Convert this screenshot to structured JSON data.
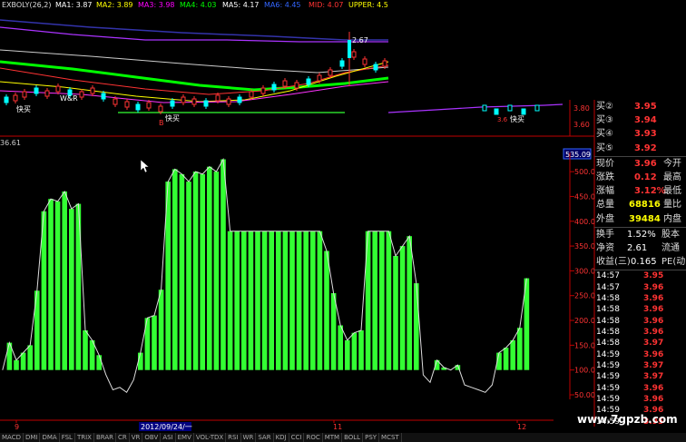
{
  "header": {
    "indicator": "EXBOLY(26,2)",
    "ma1": "MA1: 3.87",
    "ma2": "MA2: 3.89",
    "ma3": "MA3: 3.98",
    "ma4": "MA4: 4.03",
    "ma5": "MA5: 4.17",
    "ma6": "MA6: 4.45",
    "mid": "MID: 4.07",
    "upper": "UPPER: 4.5"
  },
  "upper_axis": [
    "3.80",
    "3.60"
  ],
  "upper_annotations": {
    "kuaimai_left": "快买",
    "wr": "W&R",
    "buy_marks": "B",
    "kuaimai_mid": "快买",
    "price_peak": "2.67",
    "kuaimai_right": "快买",
    "small_label": "3.6"
  },
  "lower_panel": {
    "title_value": "36.61",
    "current_marker": "535.09",
    "y_labels": [
      "500.0",
      "450.0",
      "400.0",
      "350.0",
      "300.0",
      "250.0",
      "200.0",
      "150.0",
      "100.0",
      "50.00"
    ]
  },
  "chart_data": {
    "type": "bar",
    "series": [
      {
        "values": [
          100,
          155,
          120,
          135,
          150,
          260,
          420,
          445,
          440,
          460,
          425,
          435,
          180,
          160,
          130,
          90,
          60,
          65,
          55,
          80,
          135,
          205,
          210,
          262,
          480,
          505,
          495,
          480,
          500,
          495,
          510,
          500,
          525,
          380,
          380,
          380,
          380,
          380,
          380,
          380,
          380,
          380,
          380,
          380,
          380,
          380,
          380,
          340,
          255,
          190,
          160,
          175,
          180,
          380,
          380,
          380,
          380,
          330,
          350,
          370,
          275,
          90,
          75,
          120,
          105,
          100,
          110,
          70,
          65,
          60,
          55,
          70,
          135,
          145,
          160,
          185,
          285
        ]
      }
    ],
    "ylim": [
      50,
      535
    ]
  },
  "quote": {
    "bids": [
      {
        "label": "买②",
        "value": "3.95"
      },
      {
        "label": "买③",
        "value": "3.94"
      },
      {
        "label": "买④",
        "value": "3.93"
      },
      {
        "label": "买⑤",
        "value": "3.92"
      }
    ],
    "stats": [
      {
        "l1": "现价",
        "v1": "3.96",
        "l2": "今开"
      },
      {
        "l1": "涨跌",
        "v1": "0.12",
        "l2": "最高"
      },
      {
        "l1": "涨幅",
        "v1": "3.12%",
        "l2": "最低"
      },
      {
        "l1": "总量",
        "v1": "68816",
        "l2": "量比"
      },
      {
        "l1": "外盘",
        "v1": "39484",
        "l2": "内盘"
      }
    ],
    "stats2": [
      {
        "l1": "换手",
        "v1": "1.52%",
        "l2": "股本"
      },
      {
        "l1": "净资",
        "v1": "2.61",
        "l2": "流通"
      },
      {
        "l1": "收益(三)",
        "v1": "0.165",
        "l2": "PE(动)"
      }
    ],
    "ticks": [
      {
        "t": "14:57",
        "p": "3.95",
        "c": "#ff3333"
      },
      {
        "t": "14:57",
        "p": "3.96",
        "c": "#ff3333"
      },
      {
        "t": "14:58",
        "p": "3.96",
        "c": "#ff3333"
      },
      {
        "t": "14:58",
        "p": "3.96",
        "c": "#ff3333"
      },
      {
        "t": "14:58",
        "p": "3.96",
        "c": "#ff3333"
      },
      {
        "t": "14:58",
        "p": "3.96",
        "c": "#ff3333"
      },
      {
        "t": "14:58",
        "p": "3.97",
        "c": "#ff3333"
      },
      {
        "t": "14:59",
        "p": "3.96",
        "c": "#ff3333"
      },
      {
        "t": "14:59",
        "p": "3.97",
        "c": "#ff3333"
      },
      {
        "t": "14:59",
        "p": "3.97",
        "c": "#ff3333"
      },
      {
        "t": "14:59",
        "p": "3.96",
        "c": "#ff3333"
      },
      {
        "t": "14:59",
        "p": "3.96",
        "c": "#ff3333"
      },
      {
        "t": "14:59",
        "p": "3.96",
        "c": "#ff3333"
      },
      {
        "t": "14:59",
        "p": "3.95",
        "c": "#ff3333"
      }
    ]
  },
  "x_axis": {
    "m9": "9",
    "date_box": "2012/09/24/一",
    "m11": "11",
    "m12": "12"
  },
  "tabs": [
    "MACD",
    "DMI",
    "DMA",
    "FSL",
    "TRIX",
    "BRAR",
    "CR",
    "VR",
    "OBV",
    "ASI",
    "EMV",
    "VOL-TDX",
    "RSI",
    "WR",
    "SAR",
    "KDJ",
    "CCI",
    "ROC",
    "MTM",
    "BOLL",
    "PSY",
    "MCST"
  ],
  "watermark": "www.7gpzb.com",
  "colors": {
    "bar": "#33ff33",
    "price_red": "#ff3333",
    "yellow": "#ffff00",
    "axis_red": "#c00000"
  }
}
